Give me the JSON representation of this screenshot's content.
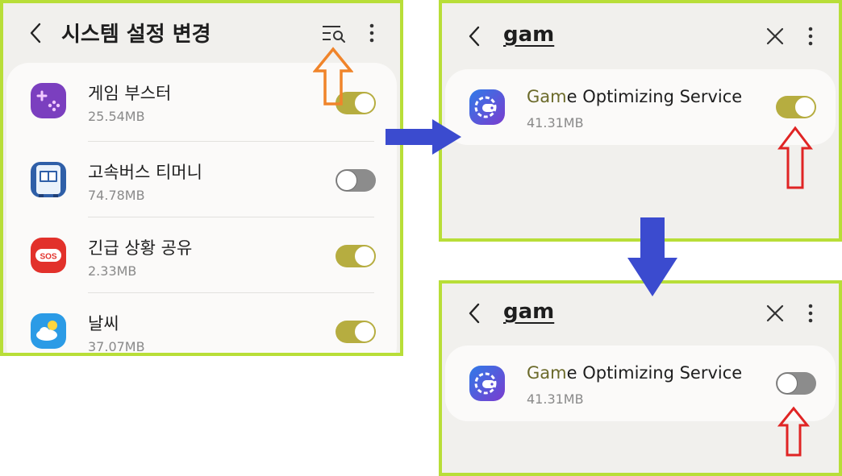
{
  "colors": {
    "panel_border": "#b8de38",
    "toggle_on": "#b6ad40",
    "toggle_off": "#8c8c8c",
    "flow_arrow": "#3b4bcf",
    "callout_orange": "#f0842a",
    "callout_red": "#e02424"
  },
  "left_panel": {
    "title": "시스템 설정 변경",
    "header_icons": [
      "back-icon",
      "search-list-icon",
      "more-icon"
    ],
    "apps": [
      {
        "name": "게임 부스터",
        "size": "25.54MB",
        "toggle": "on",
        "icon": "game-booster-icon"
      },
      {
        "name": "고속버스 티머니",
        "size": "74.78MB",
        "toggle": "off",
        "icon": "bus-icon"
      },
      {
        "name": "긴급 상황 공유",
        "size": "2.33MB",
        "toggle": "on",
        "icon": "sos-icon",
        "icon_text": "SOS"
      },
      {
        "name": "날씨",
        "size": "37.07MB",
        "toggle": "on",
        "icon": "weather-icon"
      }
    ]
  },
  "right_top_panel": {
    "search_term": "gam",
    "header_icons": [
      "back-icon",
      "clear-icon",
      "more-icon"
    ],
    "app": {
      "name_highlight": "Gam",
      "name_rest": "e Optimizing Service",
      "size": "41.31MB",
      "toggle": "on",
      "icon": "game-optimizing-icon"
    }
  },
  "right_bottom_panel": {
    "search_term": "gam",
    "header_icons": [
      "back-icon",
      "clear-icon",
      "more-icon"
    ],
    "app": {
      "name_highlight": "Gam",
      "name_rest": "e Optimizing Service",
      "size": "41.31MB",
      "toggle": "off",
      "icon": "game-optimizing-icon"
    }
  }
}
